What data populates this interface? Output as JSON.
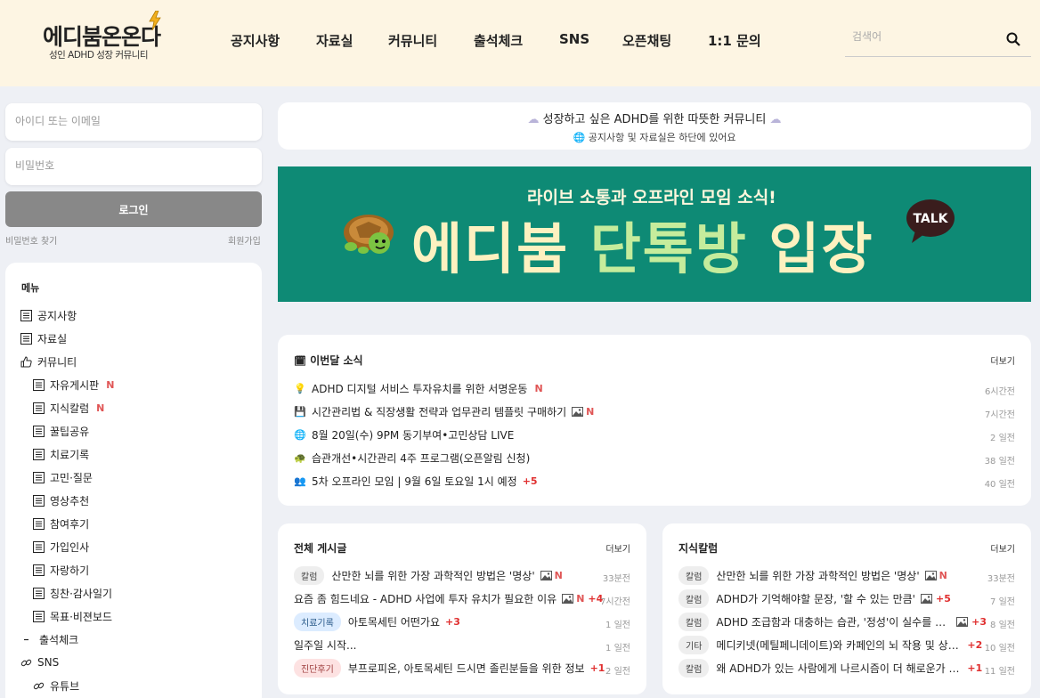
{
  "header": {
    "logo_title": "에디붐온온다",
    "logo_subtitle": "성인 ADHD 성장 커뮤니티",
    "nav": [
      "공지사항",
      "자료실",
      "커뮤니티",
      "출석체크",
      "SNS",
      "오픈채팅",
      "1:1 문의"
    ],
    "search_placeholder": "검색어"
  },
  "login": {
    "id_placeholder": "아이디 또는 이메일",
    "pw_placeholder": "비밀번호",
    "login_label": "로그인",
    "find_password": "비밀번호 찾기",
    "signup": "회원가입"
  },
  "menu": {
    "title": "메뉴",
    "items": [
      {
        "label": "공지사항",
        "new": ""
      },
      {
        "label": "자료실",
        "new": ""
      },
      {
        "label": "커뮤니티",
        "new": ""
      },
      {
        "label": "자유게시판",
        "new": "N"
      },
      {
        "label": "지식칼럼",
        "new": "N"
      },
      {
        "label": "꿀팁공유",
        "new": ""
      },
      {
        "label": "치료기록",
        "new": ""
      },
      {
        "label": "고민·질문",
        "new": ""
      },
      {
        "label": "영상추천",
        "new": ""
      },
      {
        "label": "참여후기",
        "new": ""
      },
      {
        "label": "가입인사",
        "new": ""
      },
      {
        "label": "자랑하기",
        "new": ""
      },
      {
        "label": "칭찬·감사일기",
        "new": ""
      },
      {
        "label": "목표·비젼보드",
        "new": ""
      },
      {
        "label": "출석체크",
        "new": ""
      },
      {
        "label": "SNS",
        "new": ""
      },
      {
        "label": "유튜브",
        "new": ""
      }
    ]
  },
  "intro": {
    "line1": "성장하고 싶은 ADHD를 위한 따뜻한 커뮤니티",
    "line2": "공지사항 및 자료실은 하단에 있어요"
  },
  "hero": {
    "subtitle": "라이브 소통과 오프라인 모임 소식!",
    "title_part1": "에디붐 ",
    "title_part2": "단톡방",
    "title_part3": " 입장",
    "talk": "TALK"
  },
  "monthly": {
    "title": "이번달 소식",
    "more": "더보기",
    "items": [
      {
        "text": "ADHD 디지털 서비스 투자유치를 위한 서명운동",
        "badge": "N",
        "count": "",
        "time": "6시간전",
        "icon": "bulb-icon"
      },
      {
        "text": "시간관리법 & 직장생활 전략과 업무관리 템플릿 구매하기",
        "badge": "N",
        "count": "",
        "time": "7시간전",
        "icon": "disk-icon"
      },
      {
        "text": "8월 20일(수) 9PM 동기부여•고민상담 LIVE",
        "badge": "",
        "count": "",
        "time": "2 일전",
        "icon": "globe-icon"
      },
      {
        "text": "습관개선•시간관리 4주 프로그램(오픈알림 신청)",
        "badge": "",
        "count": "",
        "time": "38 일전",
        "icon": "turtle-icon"
      },
      {
        "text": "5차 오프라인 모임 | 9월 6일 토요일 1시 예정",
        "badge": "",
        "count": "+5",
        "time": "40 일전",
        "icon": "people-icon"
      }
    ]
  },
  "all_posts": {
    "title": "전체 게시글",
    "more": "더보기",
    "items": [
      {
        "tag": "칼럼",
        "text": "산만한 뇌를 위한 가장 과학적인 방법은 '명상'",
        "badge": "N",
        "count": "",
        "time": "33분전"
      },
      {
        "tag": "",
        "text": "요즘 좀 힘드네요 - ADHD 사업에 투자 유치가 필요한 이유",
        "badge": "N",
        "count": "+4",
        "time": "7시간전"
      },
      {
        "tag": "치료기록",
        "text": "아토목세틴 어떤가요",
        "badge": "",
        "count": "+3",
        "time": "1 일전"
      },
      {
        "tag": "",
        "text": "일주일 시작...",
        "badge": "",
        "count": "",
        "time": "1 일전"
      },
      {
        "tag": "진단후기",
        "text": "부프로피온, 아토목세틴 드시면 졸린분들을 위한 정보",
        "badge": "",
        "count": "+1",
        "time": "2 일전"
      }
    ]
  },
  "columns": {
    "title": "지식칼럼",
    "more": "더보기",
    "items": [
      {
        "tag": "칼럼",
        "text": "산만한 뇌를 위한 가장 과학적인 방법은 '명상'",
        "badge": "N",
        "count": "",
        "time": "33분전"
      },
      {
        "tag": "칼럼",
        "text": "ADHD가 기억해야할 문장, '할 수 있는 만큼'",
        "badge": "",
        "count": "+5",
        "time": "7 일전"
      },
      {
        "tag": "칼럼",
        "text": "ADHD 조급함과 대충하는 습관, '정성'이 실수를 줄...",
        "badge": "",
        "count": "+3",
        "time": "8 일전"
      },
      {
        "tag": "기타",
        "text": "메디키넷(메틸페니데이트)와 카페인의 뇌 작용 및 상호 ...",
        "badge": "",
        "count": "+2",
        "time": "10 일전"
      },
      {
        "tag": "칼럼",
        "text": "왜 ADHD가 있는 사람에게 나르시즘이 더 해로운가 (해...",
        "badge": "",
        "count": "+1",
        "time": "11 일전"
      }
    ]
  }
}
